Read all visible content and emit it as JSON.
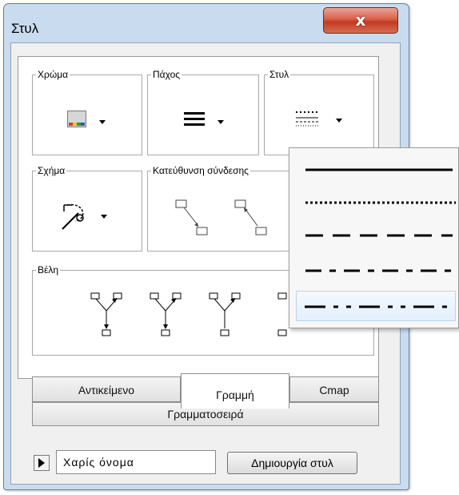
{
  "window": {
    "title": "Στυλ",
    "close_label": "x"
  },
  "groups": {
    "color": {
      "label": "Χρώμα"
    },
    "thickness": {
      "label": "Πάχος"
    },
    "style": {
      "label": "Στυλ"
    },
    "shape": {
      "label": "Σχήμα"
    },
    "direction": {
      "label": "Κατεύθυνση σύνδεσης"
    },
    "arrows": {
      "label": "Βέλη"
    }
  },
  "tabs": [
    {
      "label": "Αντικείμενο",
      "active": false
    },
    {
      "label": "Γραμμή",
      "active": true
    },
    {
      "label": "Cmap",
      "active": false
    }
  ],
  "font_tab": {
    "label": "Γραμματοσειρά"
  },
  "footer": {
    "style_name": "Χαρίς όνομα",
    "create_button": "Δημιουργία στυλ"
  },
  "line_style_popup": {
    "options": [
      {
        "name": "solid",
        "selected": false
      },
      {
        "name": "dotted",
        "selected": false
      },
      {
        "name": "dashed",
        "selected": false
      },
      {
        "name": "dash-short-dash",
        "selected": false
      },
      {
        "name": "dash-dot",
        "selected": true
      }
    ]
  },
  "colors": {
    "title_bar": "#c9dcef",
    "close_button": "#c53a22",
    "selection": "#e3effb"
  }
}
